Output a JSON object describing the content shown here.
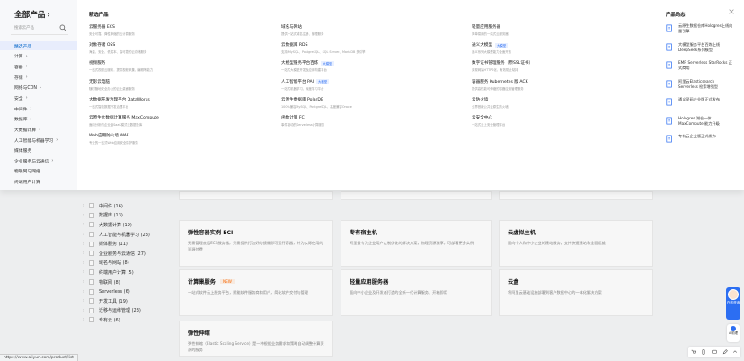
{
  "left_panel": {
    "title": "全部产品",
    "search_placeholder": "搜索云产品",
    "categories": [
      {
        "label": "精选产品",
        "active": true,
        "chevron": false
      },
      {
        "label": "计算",
        "chevron": true
      },
      {
        "label": "容器",
        "chevron": true
      },
      {
        "label": "存储",
        "chevron": true
      },
      {
        "label": "网络与CDN",
        "chevron": true
      },
      {
        "label": "安全",
        "chevron": true
      },
      {
        "label": "中间件",
        "chevron": true
      },
      {
        "label": "数据库",
        "chevron": true
      },
      {
        "label": "大数据计算",
        "chevron": true
      },
      {
        "label": "人工智能与机器学习",
        "chevron": true
      },
      {
        "label": "媒体服务",
        "chevron": false
      },
      {
        "label": "企业服务与云通信",
        "chevron": true
      },
      {
        "label": "物联网",
        "chevron": false
      },
      {
        "label": "Serverless",
        "chevron": false
      },
      {
        "label": "开发工具",
        "chevron": true
      },
      {
        "label": "迁移与运维管理",
        "chevron": true
      },
      {
        "label": "专有云",
        "chevron": true
      }
    ],
    "visible_categories": [
      {
        "label": "精选产品"
      },
      {
        "label": "计算"
      },
      {
        "label": "容器"
      },
      {
        "label": "存储"
      },
      {
        "label": "网络与CDN"
      },
      {
        "label": "安全"
      },
      {
        "label": "中间件"
      },
      {
        "label": "数据库"
      },
      {
        "label": "大数据计算"
      },
      {
        "label": "人工智能与机器学习"
      },
      {
        "label": "媒体服务"
      },
      {
        "label": "企业服务与云通信"
      },
      {
        "label": "物联网与网络"
      },
      {
        "label": "终端用户计算"
      }
    ]
  },
  "featured": {
    "heading": "精选产品",
    "columns": [
      [
        {
          "name": "云服务器 ECS",
          "desc": "安全可靠、弹性伸缩的云计算服务"
        },
        {
          "name": "对象存储 OSS",
          "desc": "海量、安全、低成本、高可靠的云存储服务"
        },
        {
          "name": "视频服务",
          "desc": "一站式视频云服务，提供视频采集、编辑等能力"
        },
        {
          "name": "无影云电脑",
          "desc": "随时随地安全办公的云上桌面服务"
        },
        {
          "name": "大数据开发治理平台 DataWorks",
          "desc": "一站式智能数据开发治理平台"
        },
        {
          "name": "云原生大数据计算服务 MaxCompute",
          "desc": "面向分析的企业级SaaS模式云数据仓库"
        },
        {
          "name": "Web应用防火墙 WAF",
          "desc": "专业的一站式Web应用安全防护服务"
        }
      ],
      [
        {
          "name": "域名与网站",
          "desc": "提供一站式域名注册、管理服务"
        },
        {
          "name": "云数据库 RDS",
          "desc": "支持 MySQL、PostgreSQL、SQL Server、MariaDB 多引擎"
        },
        {
          "name": "大模型服务平台百炼",
          "tag": "大模型",
          "desc": "一站式大模型开发及应用构建平台"
        },
        {
          "name": "人工智能平台 PAI",
          "tag": "大模型",
          "desc": "一站式机器学习、深度学习平台"
        },
        {
          "name": "云原生数据库 PolarDB",
          "desc": "100%兼容MySQL、PostgreSQL，高度兼容Oracle"
        },
        {
          "name": "函数计算 FC",
          "desc": "事件驱动的Serverless计算服务"
        }
      ],
      [
        {
          "name": "轻量应用服务器",
          "desc": "简单易用的一站式云服务器"
        },
        {
          "name": "通义大模型",
          "tag": "大模型",
          "desc": "通义系列大模型能力全面开放"
        },
        {
          "name": "数字证书管理服务（原SSL证书）",
          "desc": "实现网站HTTPS化，有效防止劫持"
        },
        {
          "name": "容器服务 Kubernetes 版 ACK",
          "desc": "提供高性能可伸缩的容器应用管理服务"
        },
        {
          "name": "云防火墙",
          "desc": "业界首款公共云原生防火墙"
        },
        {
          "name": "云安全中心",
          "desc": "一站式云上安全管理平台"
        }
      ]
    ]
  },
  "news": {
    "title": "产品动态",
    "items": [
      {
        "text": "云原生数据仓库Hologres上线向量引擎"
      },
      {
        "text": "大模型服务平台百炼上线DeepSeek系列模型"
      },
      {
        "text": "EMR Serverless StarRocks 正式商用"
      },
      {
        "text": "阿里云Elasticsearch Serverless 检索增强型"
      },
      {
        "text": "通义灵码企业版正式发布"
      },
      {
        "text": "Hologres 湖仓一体 MaxCompute 能力升级"
      },
      {
        "text": "专有云企业版正式发布"
      }
    ]
  },
  "background": {
    "filter_rows": [
      {
        "label": "中间件 (16)"
      },
      {
        "label": "数据库 (13)"
      },
      {
        "label": "大数据计算 (19)"
      },
      {
        "label": "人工智能与机器学习 (23)"
      },
      {
        "label": "媒体服务 (11)"
      },
      {
        "label": "企业服务与云通信 (27)"
      },
      {
        "label": "域名与网站 (8)"
      },
      {
        "label": "终端用户计算 (5)"
      },
      {
        "label": "物联网 (8)"
      },
      {
        "label": "Serverless (6)"
      },
      {
        "label": "开发工具 (19)"
      },
      {
        "label": "迁移与运维管理 (23)"
      },
      {
        "label": "专有云 (6)"
      }
    ],
    "cards": [
      {
        "title": "弹性容器实例 ECI",
        "desc": "无需管理底层ECS服务器，只需提供打包好的镜像即可运行容器，并为实际使用的资源付费"
      },
      {
        "title": "专有宿主机",
        "desc": "阿里云专为企业用户定制优化的解决方案，物理资源独享，可部署更多实例"
      },
      {
        "title": "云虚拟主机",
        "desc": "面向个人和中小企业的建站服务，支持快速建站和全面运维"
      },
      {
        "title": "计算巢服务",
        "badge": "NEW",
        "desc": "一站式软件云上服务平台，赋能软件服务商和用户，简化软件交付与管理"
      },
      {
        "title": "轻量应用服务器",
        "desc": "面向中小企业及开发者打造的全新一代计算服务，开箱即用"
      },
      {
        "title": "云盒",
        "desc": "将阿里云基础设施部署到客户数据中心的一体化解决方案"
      },
      {
        "title": "弹性伸缩",
        "desc": "弹性伸缩（Elastic Scaling Service）是一种根据业务需求和策略自动调整计算资源的服务"
      }
    ]
  },
  "floating": {
    "assistant_label": "在线咨询",
    "ai_label": "AI助理"
  },
  "status_url": "https://www.aliyun.com/product/list"
}
